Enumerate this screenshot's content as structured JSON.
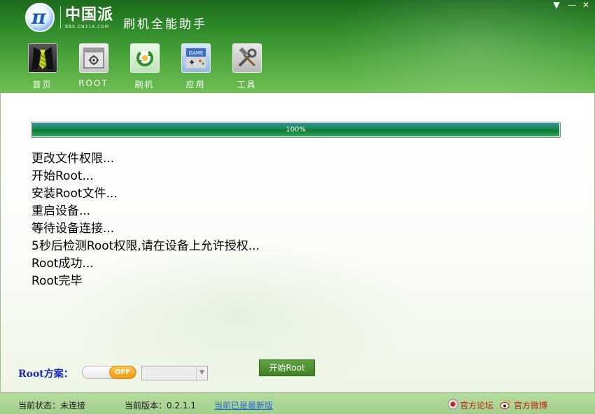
{
  "app": {
    "logo_cn": "中国派",
    "logo_en": "BBS.CN314.COM",
    "title": "刷机全能助手"
  },
  "window_controls": {
    "menu": "▼",
    "minimize": "—",
    "close": "✕"
  },
  "toolbar": [
    {
      "label": "首页",
      "icon": "necktie-icon"
    },
    {
      "label": "ROOT",
      "icon": "gear-box-icon"
    },
    {
      "label": "刷机",
      "icon": "refresh-arrows-icon"
    },
    {
      "label": "应用",
      "icon": "game-console-icon",
      "icon_text": "GAME"
    },
    {
      "label": "工具",
      "icon": "wrench-hammer-icon"
    }
  ],
  "progress": {
    "percent": 100,
    "label": "100%"
  },
  "log": [
    "更改文件权限...",
    "开始Root...",
    "安装Root文件...",
    "重启设备...",
    "等待设备连接...",
    "5秒后检测Root权限,请在设备上允许授权...",
    "Root成功...",
    "Root完毕"
  ],
  "root_scheme": {
    "label": "Root方案：",
    "toggle_text": "OFF",
    "toggle_on": false,
    "selected": ""
  },
  "start_button": "开始Root",
  "status": {
    "state": "当前状态：未连接",
    "version": "当前版本：0.2.1.1",
    "latest": "当前已是最新版",
    "forum": "官方论坛",
    "weibo": "官方微博"
  },
  "colors": {
    "header_green": "#2f8a2a",
    "progress_green": "#0f7a35",
    "scheme_blue": "#1a2ab8",
    "toggle_orange": "#f39a12",
    "link_blue": "#2466d0",
    "link_red": "#c0261c"
  }
}
